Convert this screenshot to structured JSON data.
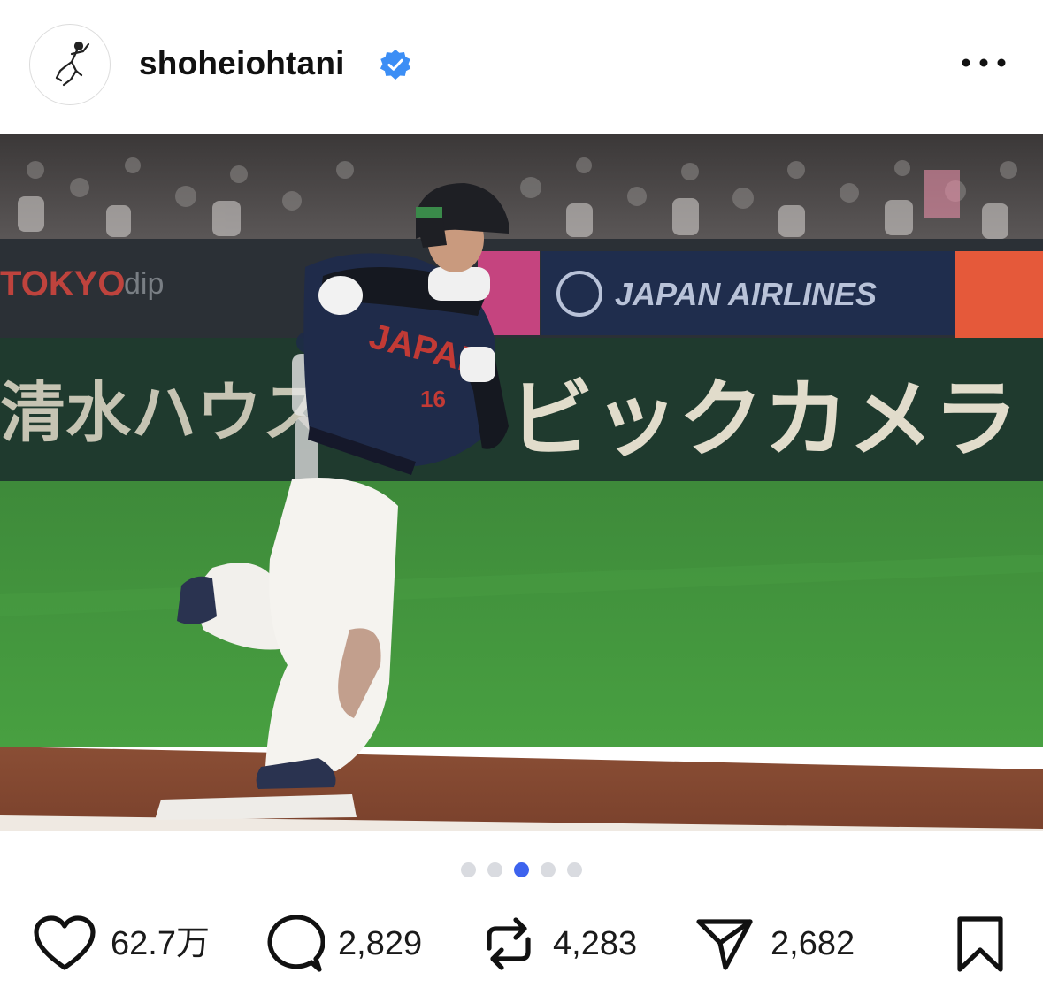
{
  "post": {
    "username": "shoheiohtani",
    "verified": true,
    "avatar_icon": "baseball-player-sketch-icon",
    "more_icon": "more-horizontal-icon"
  },
  "carousel": {
    "total": 5,
    "active_index": 2,
    "active_color": "#3d63ee",
    "inactive_color": "#d9dbe0"
  },
  "actions": {
    "likes": "62.7万",
    "comments": "2,829",
    "reposts": "4,283",
    "shares": "2,682"
  },
  "photo": {
    "jersey_text": "JAPAN",
    "jersey_number": "16",
    "banners": {
      "left_ad": "TOKYO",
      "left_ad_2": "dip",
      "airline": "JAPAN AIRLINES",
      "wall_left": "清水ハウス",
      "wall_right": "ビックカメラ"
    }
  }
}
